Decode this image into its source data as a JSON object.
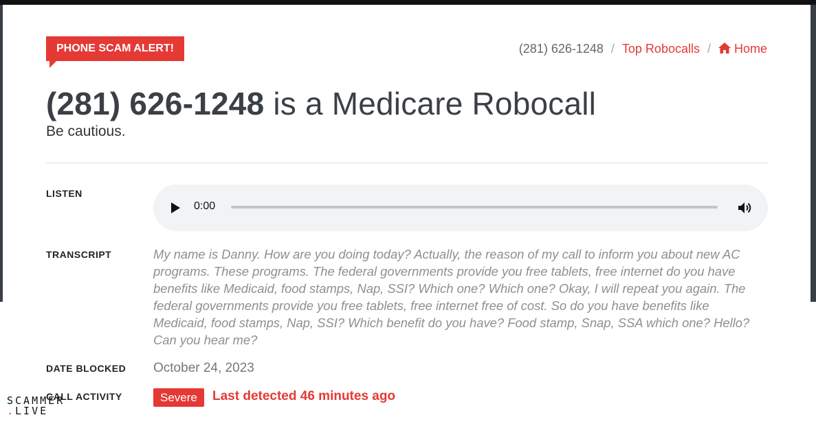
{
  "alert_badge": "PHONE SCAM ALERT!",
  "breadcrumb": {
    "phone": "(281) 626-1248",
    "top_robocalls": "Top Robocalls",
    "home": "Home",
    "separator": "/"
  },
  "title": {
    "number": "(281) 626-1248",
    "rest": " is a Medicare Robocall"
  },
  "subtitle": "Be cautious.",
  "labels": {
    "listen": "LISTEN",
    "transcript": "TRANSCRIPT",
    "date_blocked": "DATE BLOCKED",
    "call_activity": "CALL ACTIVITY"
  },
  "player": {
    "time": "0:00",
    "progress": 0
  },
  "transcript": "My name is Danny. How are you doing today? Actually, the reason of my call to inform you about new AC programs. These programs. The federal governments provide you free tablets, free internet do you have benefits like Medicaid, food stamps, Nap, SSI? Which one? Which one? Okay, I will repeat you again. The federal governments provide you free tablets, free internet free of cost. So do you have benefits like Medicaid, food stamps, Nap, SSI? Which benefit do you have? Food stamp, Snap, SSA which one? Hello? Can you hear me?",
  "date_blocked": "October 24, 2023",
  "call_activity": {
    "severity": "Severe",
    "last_detected": "Last detected 46 minutes ago"
  },
  "watermark": {
    "line1": "SCAMMER",
    "dot": ".",
    "line2": "LIVE"
  },
  "colors": {
    "accent": "#e53935",
    "text_dark": "#3b3f46",
    "muted": "#8f8f8f"
  },
  "icons": {
    "home": "home-icon",
    "play": "play-icon",
    "volume": "volume-icon"
  }
}
